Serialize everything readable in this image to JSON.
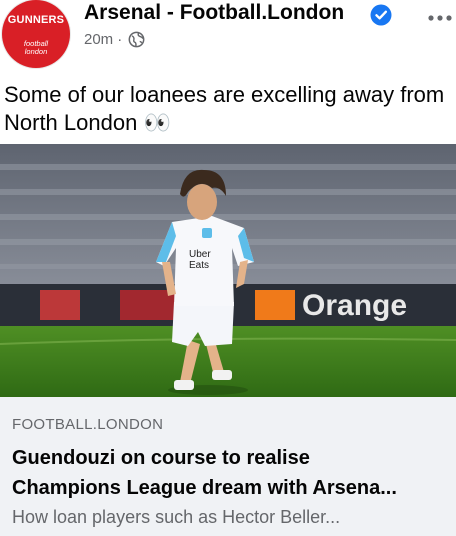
{
  "post": {
    "page_name": "Arsenal - Football.London",
    "time": "20m",
    "privacy_icon": "globe-icon",
    "verified_icon": "verified-badge-icon",
    "caption": "Some of our loanees are excelling away from North London",
    "caption_emoji": "👀"
  },
  "avatar": {
    "brand": "GUNNERS",
    "sub_line1": "football",
    "sub_line2": "london"
  },
  "photo": {
    "shirt_sponsor_line1": "Uber",
    "shirt_sponsor_line2": "Eats",
    "board_text": "Orange"
  },
  "link_preview": {
    "domain": "FOOTBALL.LONDON",
    "headline_line1": "Guendouzi on course to realise",
    "headline_line2": "Champions League dream with Arsena...",
    "subtitle": "How loan players such as Hector Beller..."
  },
  "colors": {
    "brand_red": "#d91f26",
    "verified_blue": "#1877f2",
    "secondary_text": "#65676b",
    "preview_bg": "#f0f2f5"
  }
}
